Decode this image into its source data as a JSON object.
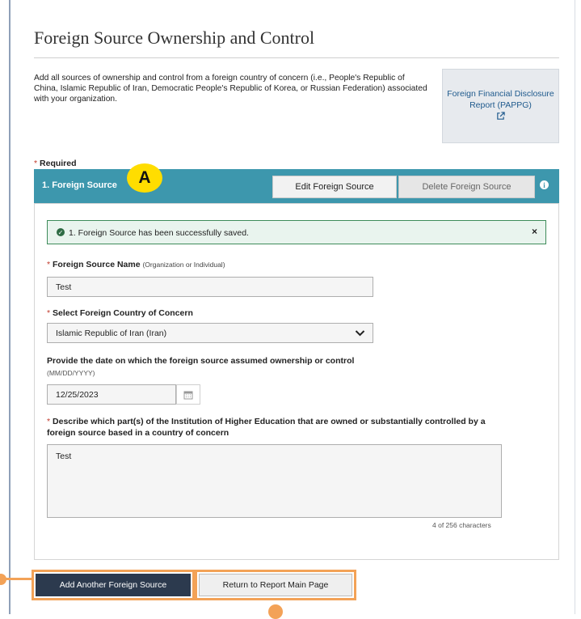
{
  "page": {
    "title": "Foreign Source Ownership and Control",
    "intro": "Add all sources of ownership and control from a foreign country of concern (i.e., People's Republic of China, Islamic Republic of Iran, Democratic People's Republic of Korea, or Russian Federation) associated with your organization."
  },
  "pappg_link": {
    "label": "Foreign Financial Disclosure Report (PAPPG)",
    "icon": "external-link-icon"
  },
  "required_note": "Required",
  "section": {
    "title": "1. Foreign Source",
    "edit_label": "Edit Foreign Source",
    "delete_label": "Delete Foreign Source",
    "info_icon": "info-icon",
    "header_color": "#3d97ad"
  },
  "annotation": {
    "marker_label": "A",
    "marker_color": "#ffdd00",
    "highlight_color": "#f3a257"
  },
  "alert": {
    "message": "1. Foreign Source has been successfully saved.",
    "close_symbol": "×",
    "icon": "check-circle-icon"
  },
  "form": {
    "name_label": "Foreign Source Name",
    "name_hint": "(Organization or Individual)",
    "name_value": "Test",
    "country_label": "Select Foreign Country of Concern",
    "country_value": "Islamic Republic of Iran (Iran)",
    "date_label": "Provide the date on which the foreign source assumed ownership or control",
    "date_hint": "(MM/DD/YYYY)",
    "date_value": "12/25/2023",
    "describe_label": "Describe which part(s) of the Institution of Higher Education that are owned or substantially controlled by a foreign source based in a country of concern",
    "describe_value": "Test",
    "char_count": "4 of 256 characters"
  },
  "actions": {
    "add_label": "Add Another Foreign Source",
    "return_label": "Return to Report Main Page"
  }
}
